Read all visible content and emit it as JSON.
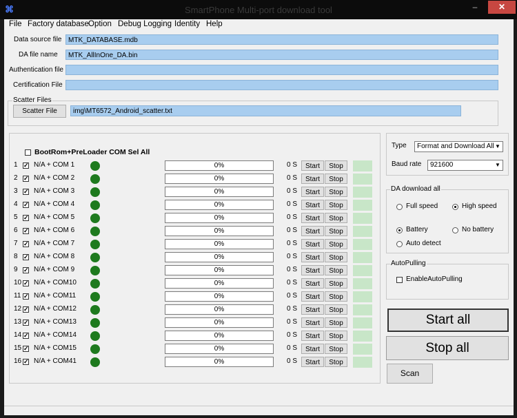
{
  "window": {
    "title": "SmartPhone Multi-port download tool",
    "minimize": "–",
    "maximize": "☐",
    "close": "✕"
  },
  "menu": [
    "File",
    "Factory database",
    "Option",
    "Debug Logging",
    "Identity",
    "Help"
  ],
  "fields": [
    {
      "label": "Data source file",
      "value": "MTK_DATABASE.mdb"
    },
    {
      "label": "DA file name",
      "value": "MTK_AllInOne_DA.bin"
    },
    {
      "label": "Authentication file",
      "value": ""
    },
    {
      "label": "Certification File",
      "value": ""
    }
  ],
  "scatter": {
    "group_title": "Scatter Files",
    "button": "Scatter File",
    "value": "img\\MT6572_Android_scatter.txt"
  },
  "ports": {
    "select_all": "BootRom+PreLoader COM Sel All",
    "start_label": "Start",
    "stop_label": "Stop",
    "rows": [
      {
        "num": "1",
        "port": "N/A + COM 1",
        "progress": "0%",
        "time": "0 S"
      },
      {
        "num": "2",
        "port": "N/A + COM 2",
        "progress": "0%",
        "time": "0 S"
      },
      {
        "num": "3",
        "port": "N/A + COM 3",
        "progress": "0%",
        "time": "0 S"
      },
      {
        "num": "4",
        "port": "N/A + COM 4",
        "progress": "0%",
        "time": "0 S"
      },
      {
        "num": "5",
        "port": "N/A + COM 5",
        "progress": "0%",
        "time": "0 S"
      },
      {
        "num": "6",
        "port": "N/A + COM 6",
        "progress": "0%",
        "time": "0 S"
      },
      {
        "num": "7",
        "port": "N/A + COM 7",
        "progress": "0%",
        "time": "0 S"
      },
      {
        "num": "8",
        "port": "N/A + COM 8",
        "progress": "0%",
        "time": "0 S"
      },
      {
        "num": "9",
        "port": "N/A + COM 9",
        "progress": "0%",
        "time": "0 S"
      },
      {
        "num": "10",
        "port": "N/A + COM10",
        "progress": "0%",
        "time": "0 S"
      },
      {
        "num": "11",
        "port": "N/A + COM11",
        "progress": "0%",
        "time": "0 S"
      },
      {
        "num": "12",
        "port": "N/A + COM12",
        "progress": "0%",
        "time": "0 S"
      },
      {
        "num": "13",
        "port": "N/A + COM13",
        "progress": "0%",
        "time": "0 S"
      },
      {
        "num": "14",
        "port": "N/A + COM14",
        "progress": "0%",
        "time": "0 S"
      },
      {
        "num": "15",
        "port": "N/A + COM15",
        "progress": "0%",
        "time": "0 S"
      },
      {
        "num": "16",
        "port": "N/A + COM41",
        "progress": "0%",
        "time": "0 S"
      }
    ]
  },
  "type": {
    "label": "Type",
    "value": "Format and Download All"
  },
  "baud": {
    "label": "Baud rate",
    "value": "921600"
  },
  "da_download": {
    "title": "DA download all",
    "full_speed": "Full speed",
    "high_speed": "High speed",
    "battery": "Battery",
    "no_battery": "No battery",
    "auto_detect": "Auto detect"
  },
  "auto_pulling": {
    "title": "AutoPulling",
    "checkbox": "EnableAutoPulling"
  },
  "actions": {
    "start_all": "Start all",
    "stop_all": "Stop all",
    "scan": "Scan"
  },
  "colors": {
    "field_bg": "#a8cdef",
    "led": "#1e7a1e",
    "status_cell": "#c8e6c8",
    "close_button": "#c74741"
  }
}
